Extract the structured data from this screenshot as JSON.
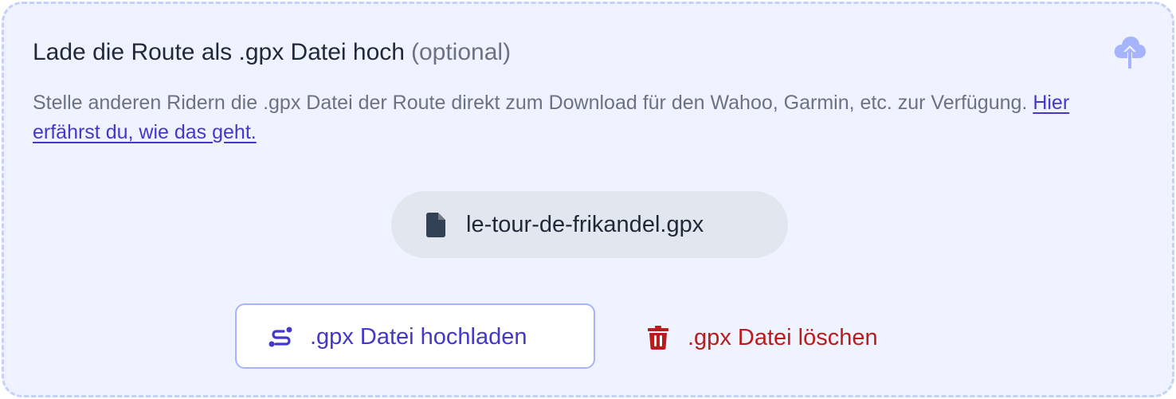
{
  "header": {
    "title": "Lade die Route als .gpx Datei hoch",
    "optional": "(optional)",
    "icon": "cloud-upload-icon"
  },
  "description": {
    "text": "Stelle anderen Ridern die .gpx Datei der Route direkt zum Download für den Wahoo, Garmin, etc. zur Verfügung.",
    "link_text": "Hier erfährst du, wie das geht."
  },
  "file": {
    "name": "le-tour-de-frikandel.gpx",
    "icon": "file-icon"
  },
  "actions": {
    "upload_label": ".gpx Datei hochladen",
    "upload_icon": "route-icon",
    "delete_label": ".gpx Datei löschen",
    "delete_icon": "trash-icon"
  },
  "colors": {
    "accent": "#4338ca",
    "danger": "#b91c1c",
    "panel_bg": "#eff3ff",
    "border": "#c5d2f7"
  }
}
